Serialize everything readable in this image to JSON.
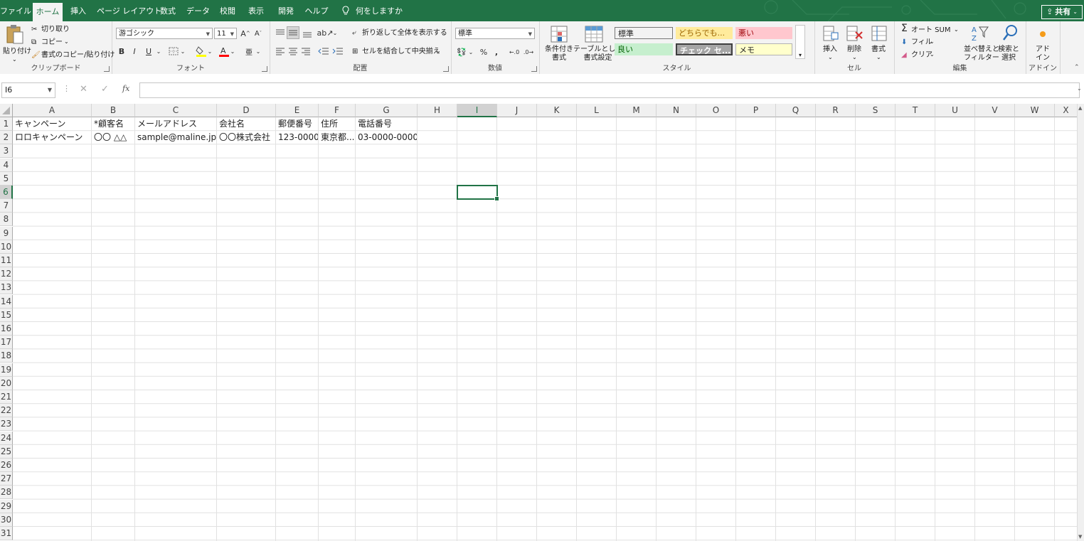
{
  "menu": {
    "tabs": [
      "ファイル",
      "ホーム",
      "挿入",
      "ページ レイアウト",
      "数式",
      "データ",
      "校閲",
      "表示",
      "開発",
      "ヘルプ"
    ],
    "active_tab": "ホーム",
    "tell_me": "何をしますか",
    "share": "共有"
  },
  "ribbon": {
    "clipboard": {
      "label": "クリップボード",
      "paste": "貼り付け",
      "cut": "切り取り",
      "copy": "コピー",
      "format_painter": "書式のコピー/貼り付け"
    },
    "font": {
      "label": "フォント",
      "font_name": "游ゴシック",
      "font_size": "11",
      "bold": "B",
      "italic": "I",
      "underline": "U"
    },
    "alignment": {
      "label": "配置",
      "wrap_text": "折り返して全体を表示する",
      "merge_center": "セルを結合して中央揃え"
    },
    "number": {
      "label": "数値",
      "format": "標準",
      "percent": "%",
      "comma": ","
    },
    "styles": {
      "label": "スタイル",
      "conditional": "条件付き\n書式",
      "table": "テーブルとして\n書式設定",
      "cells": [
        {
          "text": "標準",
          "bg": "#ffffff",
          "fg": "#000000"
        },
        {
          "text": "どちらでも...",
          "bg": "#ffeb9c",
          "fg": "#9c6500"
        },
        {
          "text": "悪い",
          "bg": "#ffc7ce",
          "fg": "#9c0006"
        },
        {
          "text": "良い",
          "bg": "#c6efce",
          "fg": "#006100"
        },
        {
          "text": "チェック セ...",
          "bg": "#a5a5a5",
          "fg": "#ffffff"
        },
        {
          "text": "メモ",
          "bg": "#ffffcc",
          "fg": "#222222"
        }
      ]
    },
    "cells": {
      "label": "セル",
      "insert": "挿入",
      "delete": "削除",
      "format": "書式"
    },
    "editing": {
      "label": "編集",
      "autosum": "オート SUM",
      "fill": "フィル",
      "clear": "クリア",
      "sort": "並べ替えと\nフィルター",
      "find": "検索と\n選択"
    },
    "addins": {
      "label": "アドイン",
      "addin": "アド\nイン"
    }
  },
  "formula_bar": {
    "name_box": "I6",
    "fx": "fx",
    "value": ""
  },
  "sheet": {
    "columns": [
      "A",
      "B",
      "C",
      "D",
      "E",
      "F",
      "G",
      "H",
      "I",
      "J",
      "K",
      "L",
      "M",
      "N",
      "O",
      "P",
      "Q",
      "R",
      "S",
      "T",
      "U",
      "V",
      "W",
      "X"
    ],
    "rows": [
      "1",
      "2",
      "3",
      "4",
      "5",
      "6",
      "7",
      "8",
      "9",
      "10",
      "11",
      "12",
      "13",
      "14",
      "15",
      "16",
      "17",
      "18",
      "19",
      "20",
      "21",
      "22",
      "23",
      "24",
      "25",
      "26",
      "27",
      "28",
      "29",
      "30",
      "31"
    ],
    "selected_col": "I",
    "selected_row": "6",
    "data": [
      [
        "キャンペーン",
        "*顧客名",
        "メールアドレス",
        "会社名",
        "郵便番号",
        "住所",
        "電話番号"
      ],
      [
        "ロロキャンペーン",
        "〇〇 △△",
        "sample@maline.jp",
        "〇〇株式会社",
        "123-0000",
        "東京都...",
        "03-0000-0000"
      ]
    ]
  },
  "colors": {
    "accent": "#217346",
    "ribbon_bg": "#f3f3f3",
    "grid_line": "#e1e1e1"
  }
}
